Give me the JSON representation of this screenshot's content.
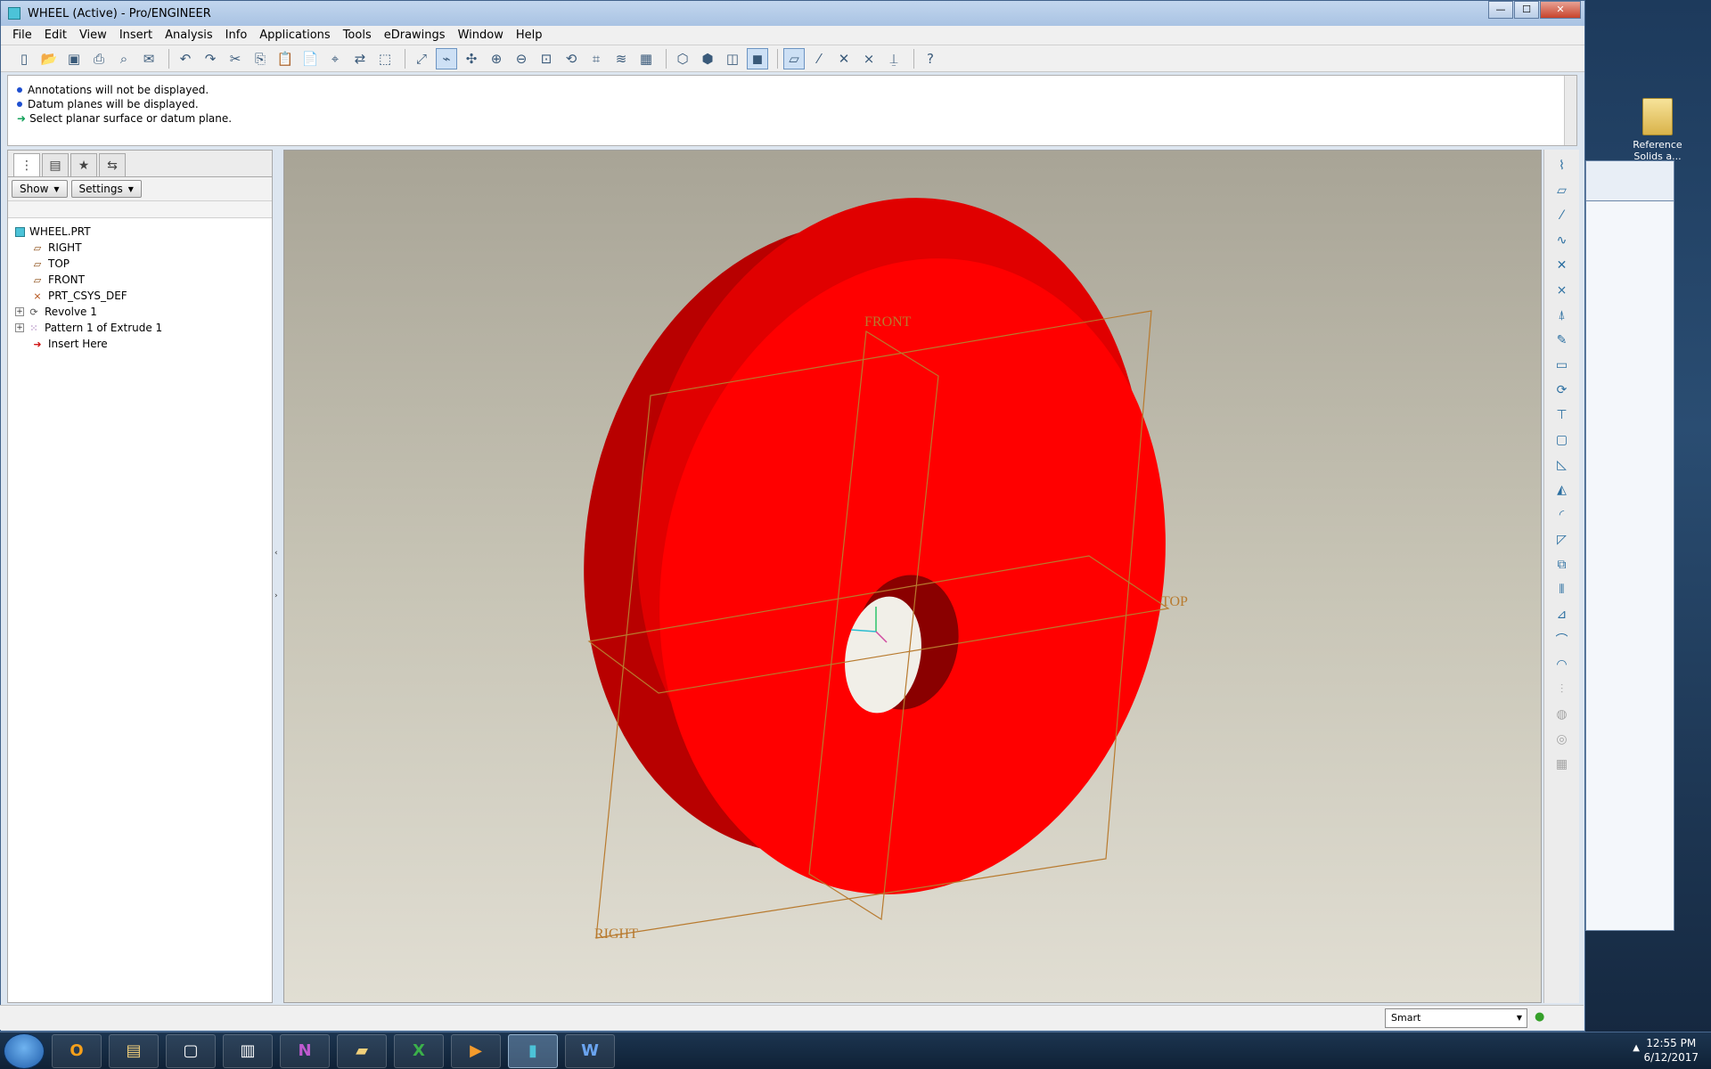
{
  "window": {
    "title": "WHEEL (Active) - Pro/ENGINEER",
    "minimize": "—",
    "maximize": "☐",
    "close": "✕"
  },
  "menu": [
    "File",
    "Edit",
    "View",
    "Insert",
    "Analysis",
    "Info",
    "Applications",
    "Tools",
    "eDrawings",
    "Window",
    "Help"
  ],
  "messages": [
    {
      "type": "info",
      "text": "Annotations will not be displayed."
    },
    {
      "type": "info",
      "text": "Datum planes will be displayed."
    },
    {
      "type": "prompt",
      "text": "Select planar surface or datum plane."
    }
  ],
  "tree": {
    "show_label": "Show",
    "settings_label": "Settings",
    "items": [
      {
        "label": "WHEEL.PRT",
        "icon": "part-icon",
        "level": 0,
        "expander": ""
      },
      {
        "label": "RIGHT",
        "icon": "datum-plane-icon",
        "level": 1,
        "expander": ""
      },
      {
        "label": "TOP",
        "icon": "datum-plane-icon",
        "level": 1,
        "expander": ""
      },
      {
        "label": "FRONT",
        "icon": "datum-plane-icon",
        "level": 1,
        "expander": ""
      },
      {
        "label": "PRT_CSYS_DEF",
        "icon": "csys-icon",
        "level": 1,
        "expander": ""
      },
      {
        "label": "Revolve 1",
        "icon": "revolve-icon",
        "level": 1,
        "expander": "+"
      },
      {
        "label": "Pattern 1 of Extrude 1",
        "icon": "pattern-icon",
        "level": 1,
        "expander": "+"
      },
      {
        "label": "Insert Here",
        "icon": "insert-arrow-icon",
        "level": 1,
        "expander": ""
      }
    ]
  },
  "graphics": {
    "plane_labels": {
      "front": "FRONT",
      "top": "TOP",
      "right": "RIGHT"
    },
    "model_color": "#ff0000",
    "datum_color": "#b87a2e",
    "background_top": "#a8a496",
    "background_bottom": "#e1ded3"
  },
  "status": {
    "filter_value": "Smart"
  },
  "desktop": {
    "icon_label": "Reference Solids a..."
  },
  "tray": {
    "time": "12:55 PM",
    "date": "6/12/2017"
  },
  "taskbar_apps": [
    {
      "name": "outlook",
      "glyph": "O"
    },
    {
      "name": "file-explorer",
      "glyph": "▤"
    },
    {
      "name": "window",
      "glyph": "▢"
    },
    {
      "name": "app",
      "glyph": "▥"
    },
    {
      "name": "onenote",
      "glyph": "N"
    },
    {
      "name": "folder",
      "glyph": "▰"
    },
    {
      "name": "excel",
      "glyph": "X"
    },
    {
      "name": "media",
      "glyph": "▶"
    },
    {
      "name": "proengineer",
      "glyph": "▮"
    },
    {
      "name": "word",
      "glyph": "W"
    }
  ]
}
